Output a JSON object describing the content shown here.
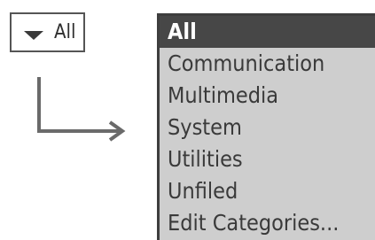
{
  "category_picker": {
    "selected_label": "All",
    "caret_icon": "triangle-down-icon"
  },
  "connector": {
    "icon": "elbow-arrow-right-icon"
  },
  "popup": {
    "items": [
      {
        "label": "All",
        "selected": true
      },
      {
        "label": "Communication",
        "selected": false
      },
      {
        "label": "Multimedia",
        "selected": false
      },
      {
        "label": "System",
        "selected": false
      },
      {
        "label": "Utilities",
        "selected": false
      },
      {
        "label": "Unfiled",
        "selected": false
      },
      {
        "label": "Edit Categories...",
        "selected": false
      }
    ]
  },
  "colors": {
    "popup_background": "#cecece",
    "selected_background": "#474747",
    "selected_text": "#ffffff",
    "item_text": "#3a3a3a",
    "border": "#3e3e3e"
  }
}
